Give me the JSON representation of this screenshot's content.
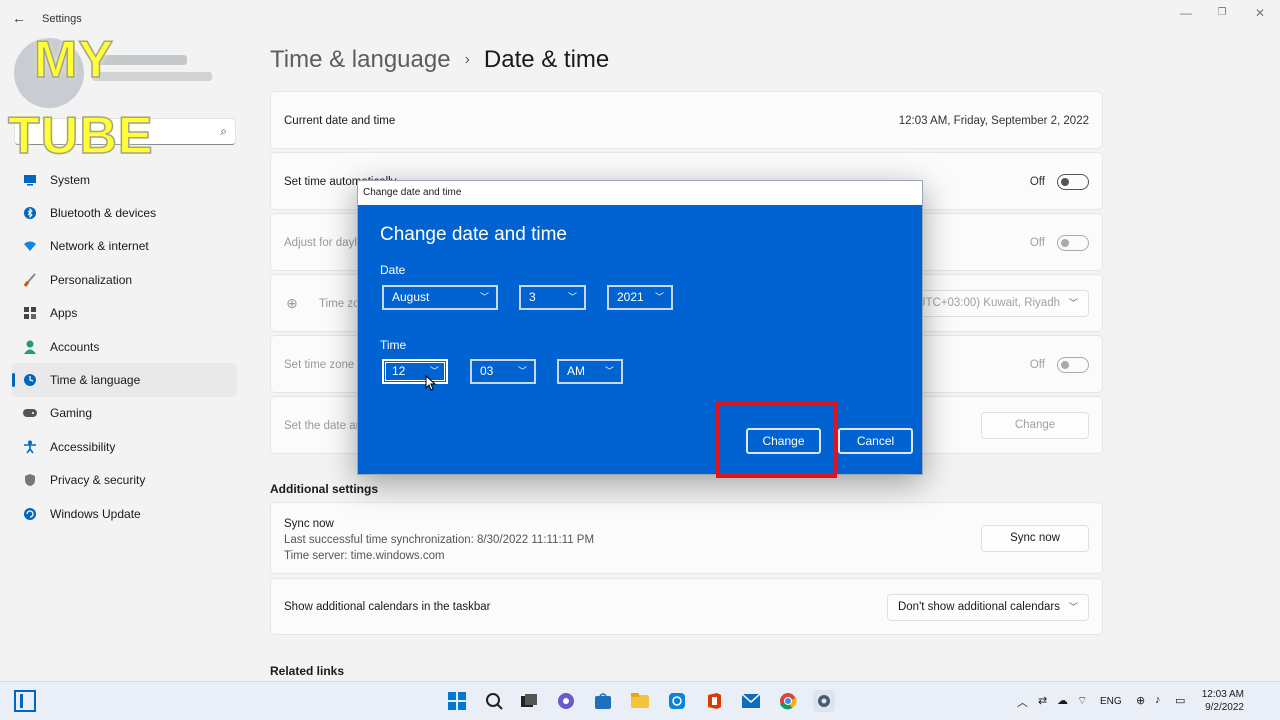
{
  "window": {
    "title": "Settings",
    "back_icon": "arrow-left-icon",
    "controls": [
      "minimize-icon",
      "maximize-icon",
      "close-icon"
    ]
  },
  "watermark": {
    "line1": "MY",
    "line2": "TUBE"
  },
  "search": {
    "placeholder": "",
    "icon": "search-icon"
  },
  "sidebar": {
    "items": [
      {
        "label": "System",
        "icon": "monitor-icon",
        "color": "#0067c0"
      },
      {
        "label": "Bluetooth & devices",
        "icon": "bluetooth-icon",
        "color": "#0067c0"
      },
      {
        "label": "Network & internet",
        "icon": "wifi-icon",
        "color": "#1a86d9"
      },
      {
        "label": "Personalization",
        "icon": "brush-icon",
        "color": "#c25b1a"
      },
      {
        "label": "Apps",
        "icon": "apps-icon",
        "color": "#444444"
      },
      {
        "label": "Accounts",
        "icon": "person-icon",
        "color": "#1f9e6a"
      },
      {
        "label": "Time & language",
        "icon": "globe-clock-icon",
        "color": "#0067c0",
        "active": true
      },
      {
        "label": "Gaming",
        "icon": "gamepad-icon",
        "color": "#555555"
      },
      {
        "label": "Accessibility",
        "icon": "accessibility-icon",
        "color": "#0067c0"
      },
      {
        "label": "Privacy & security",
        "icon": "shield-icon",
        "color": "#666666"
      },
      {
        "label": "Windows Update",
        "icon": "update-icon",
        "color": "#0067c0"
      }
    ]
  },
  "breadcrumb": {
    "parent": "Time & language",
    "separator": "›",
    "current": "Date & time"
  },
  "main": {
    "current_date": {
      "label": "Current date and time",
      "value": "12:03 AM, Friday, September 2, 2022"
    },
    "set_time_auto": {
      "label": "Set time automatically",
      "state": "Off"
    },
    "daylight": {
      "label": "Adjust for daylight saving time automatically",
      "state": "Off"
    },
    "time_zone": {
      "label": "Time zone",
      "value": "(UTC+03:00) Kuwait, Riyadh"
    },
    "set_tz_auto": {
      "label": "Set time zone automatically",
      "state": "Off"
    },
    "manual": {
      "label": "Set the date and time manually",
      "button": "Change"
    },
    "additional_title": "Additional settings",
    "sync": {
      "title": "Sync now",
      "last_sync": "Last successful time synchronization: 8/30/2022 11:11:11 PM",
      "server": "Time server: time.windows.com",
      "button": "Sync now"
    },
    "calendars": {
      "label": "Show additional calendars in the taskbar",
      "value": "Don't show additional calendars"
    },
    "related_title": "Related links"
  },
  "dialog": {
    "window_title": "Change date and time",
    "heading": "Change date and time",
    "date_label": "Date",
    "month": "August",
    "day": "3",
    "year": "2021",
    "time_label": "Time",
    "hour": "12",
    "minute": "03",
    "ampm": "AM",
    "change_button": "Change",
    "cancel_button": "Cancel",
    "highlight_color": "#e0141e"
  },
  "taskbar": {
    "apps": [
      "widgets-icon",
      "start-icon",
      "search-icon",
      "file-explorer-icon",
      "chat-icon",
      "store-icon",
      "folder-icon",
      "outlook-icon",
      "office-icon",
      "mail-icon",
      "chrome-icon",
      "settings-icon"
    ],
    "language": "ENG",
    "time": "12:03 AM",
    "date": "9/2/2022"
  },
  "colors": {
    "accent": "#0067c0",
    "dialog_bg": "#0063d1"
  }
}
